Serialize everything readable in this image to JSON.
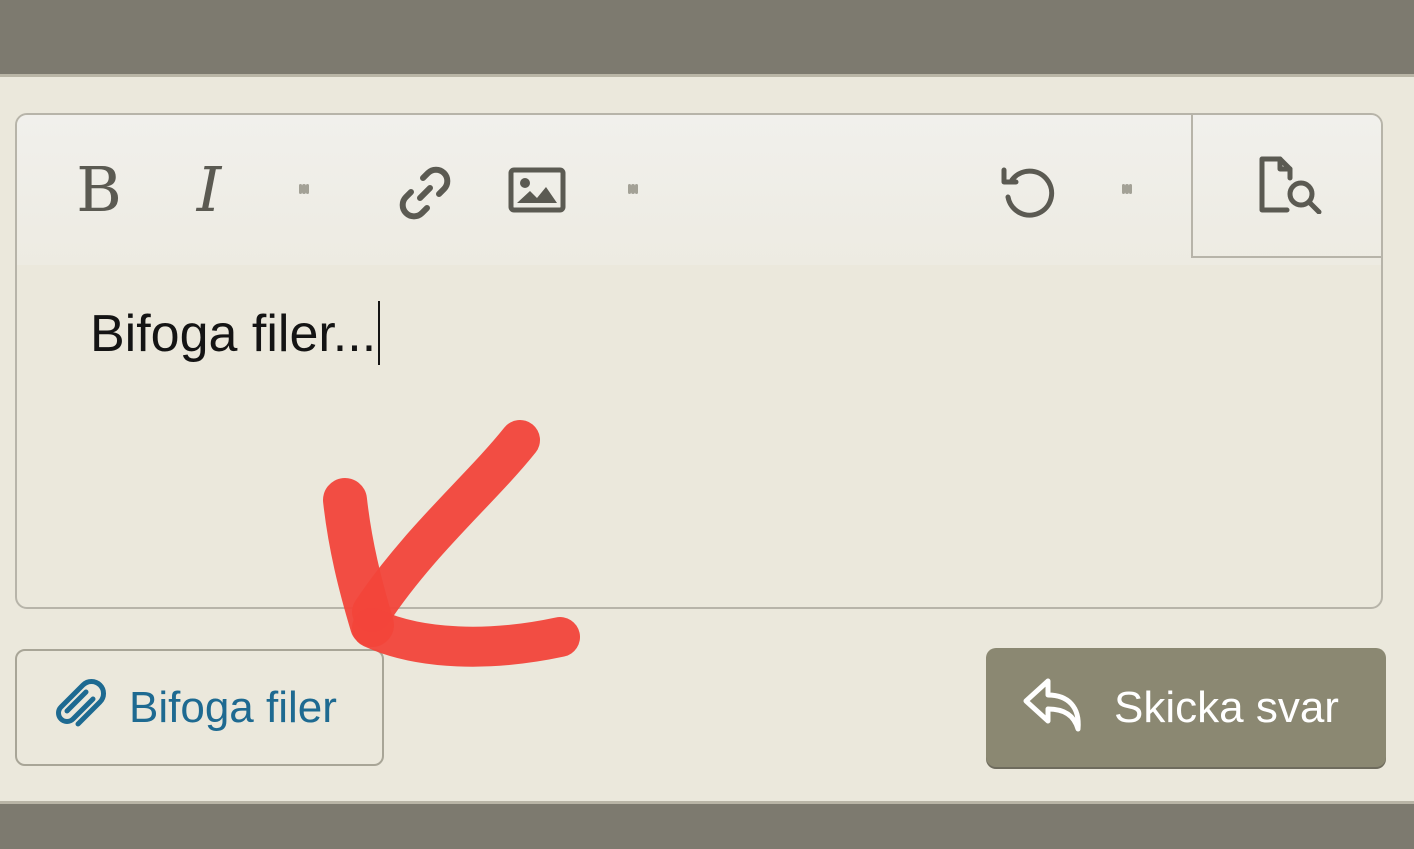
{
  "editor": {
    "content": "Bifoga filer...",
    "toolbar": {
      "bold_label": "B",
      "italic_label": "I"
    }
  },
  "actions": {
    "attach_label": "Bifoga filer",
    "send_label": "Skicka svar"
  },
  "colors": {
    "accent": "#1e6a91",
    "send_button": "#8b8872",
    "annotation": "#f2443a",
    "bar": "#7d7a6f"
  },
  "icons": {
    "link": "link-icon",
    "image": "image-icon",
    "undo": "undo-icon",
    "more": "more-vertical-icon",
    "preview": "preview-search-icon",
    "attach": "paperclip-icon",
    "send": "reply-icon"
  }
}
